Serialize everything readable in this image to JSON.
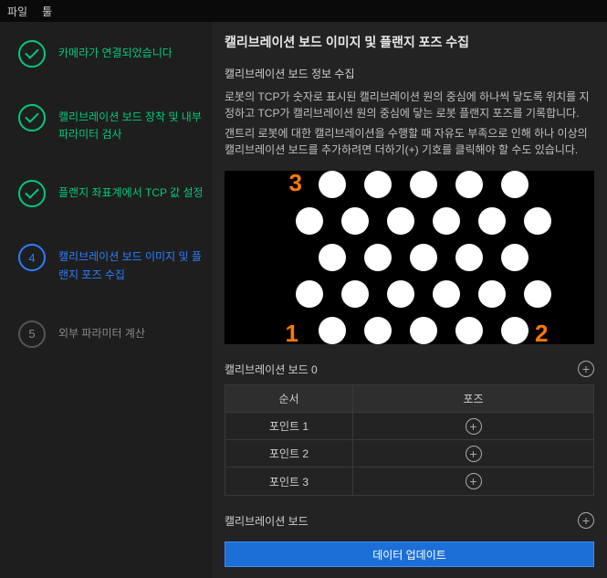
{
  "menu": {
    "file": "파일",
    "tools": "툴"
  },
  "steps": [
    {
      "num": "1",
      "label": "카메라가 연결되었습니다",
      "state": "done"
    },
    {
      "num": "2",
      "label": "캘리브레이션 보드 장착 및 내부 파라미터 검사",
      "state": "done"
    },
    {
      "num": "3",
      "label": "플랜지 좌표계에서 TCP 값 설정",
      "state": "done"
    },
    {
      "num": "4",
      "label": "캘리브레이션 보드 이미지 및 플랜지 포즈 수집",
      "state": "active"
    },
    {
      "num": "5",
      "label": "외부 파라미터 계산",
      "state": "pending"
    }
  ],
  "main": {
    "title": "캘리브레이션 보드 이미지 및 플랜지 포즈 수집",
    "subtitle": "캘리브레이션 보드 정보 수집",
    "p1": "로봇의 TCP가 숫자로 표시된 캘리브레이션 원의 중심에 하나씩 닿도록 위치를 지정하고 TCP가 캘리브레이션 원의 중심에 닿는 로봇 플랜지 포즈를 기록합니다.",
    "p2": "갠트리 로봇에 대한 캘리브레이션을 수행할 때 자유도 부족으로 인해 하나 이상의 캘리브레이션 보드를 추가하려면 더하기(+) 기호를 클릭해야 할 수도 있습니다.",
    "corners": {
      "tl": "3",
      "bl": "1",
      "br": "2"
    }
  },
  "board_section": {
    "title": "캘리브레이션 보드 0"
  },
  "table": {
    "col1": "순서",
    "col2": "포즈",
    "rows": [
      {
        "label": "포인트 1"
      },
      {
        "label": "포인트 2"
      },
      {
        "label": "포인트 3"
      }
    ]
  },
  "footer_section": {
    "label": "캘리브레이션 보드"
  },
  "update_button": "데이터 업데이트"
}
